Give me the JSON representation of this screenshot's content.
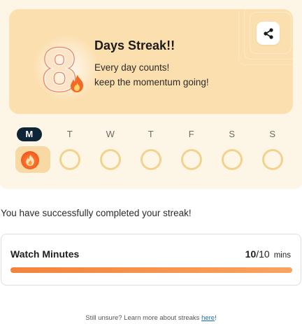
{
  "streak": {
    "count": "8",
    "title": "Days Streak!!",
    "subtitle_line1": "Every day counts!",
    "subtitle_line2": "keep the momentum going!",
    "share_icon": "share-icon",
    "accent_color": "#e9783c"
  },
  "week": {
    "days": [
      "M",
      "T",
      "W",
      "T",
      "F",
      "S",
      "S"
    ],
    "active_index": 0,
    "completed": [
      true,
      false,
      false,
      false,
      false,
      false,
      false
    ]
  },
  "status_message": "You have successfully completed your streak!",
  "watch": {
    "title": "Watch Minutes",
    "current": "10",
    "total": "/10",
    "unit": "mins",
    "progress_fraction": 1.0
  },
  "footer": {
    "text": "Still unsure? Learn more about streaks ",
    "link_text": "here",
    "suffix": "!"
  }
}
